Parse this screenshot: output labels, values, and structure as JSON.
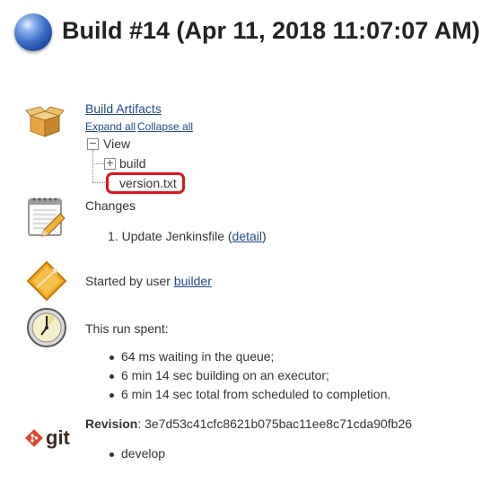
{
  "header": {
    "title": "Build #14 (Apr 11, 2018 11:07:07 AM)"
  },
  "artifacts": {
    "title": "Build Artifacts",
    "expand_all": "Expand all",
    "collapse_all": "Collapse all",
    "tree": {
      "root": "View",
      "folder": "build",
      "file": "version.txt"
    }
  },
  "changes": {
    "title": "Changes",
    "item_number": "1.",
    "item_text": "Update Jenkinsfile (",
    "item_link": "detail",
    "item_close": ")"
  },
  "started": {
    "prefix": "Started by user ",
    "user": "builder"
  },
  "timing": {
    "title": "This run spent:",
    "items": [
      "64 ms waiting in the queue;",
      "6 min 14 sec building on an executor;",
      "6 min 14 sec total from scheduled to completion."
    ]
  },
  "git": {
    "logo_text": "git",
    "revision_label": "Revision",
    "revision_value": ": 3e7d53c41cfc8621b075bac11ee8c71cda90fb26",
    "branches": [
      "develop"
    ]
  },
  "colors": {
    "link": "#204a87",
    "highlight": "#e0141a",
    "git": "#e0462d"
  }
}
